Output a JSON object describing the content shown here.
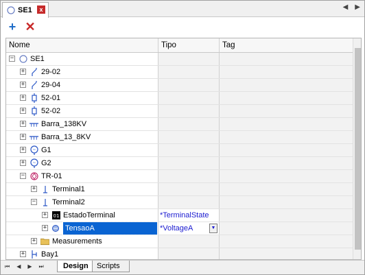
{
  "tab": {
    "title": "SE1",
    "close_glyph": "x"
  },
  "tab_nav": {
    "prev": "◀",
    "next": "▶"
  },
  "toolbar": {
    "add_icon": "plus-icon",
    "delete_icon": "delete-x-icon",
    "add_glyph": "+",
    "delete_glyph": "✕"
  },
  "columns": {
    "name": "Nome",
    "type": "Tipo",
    "tag": "Tag"
  },
  "tree": [
    {
      "label": "SE1",
      "type": "",
      "level": 0,
      "expander": "minus",
      "icon": "circle-icon"
    },
    {
      "label": "29-02",
      "type": "",
      "level": 1,
      "expander": "plus",
      "icon": "switch-icon"
    },
    {
      "label": "29-04",
      "type": "",
      "level": 1,
      "expander": "plus",
      "icon": "switch-icon"
    },
    {
      "label": "52-01",
      "type": "",
      "level": 1,
      "expander": "plus",
      "icon": "breaker-icon"
    },
    {
      "label": "52-02",
      "type": "",
      "level": 1,
      "expander": "plus",
      "icon": "breaker-icon"
    },
    {
      "label": "Barra_138KV",
      "type": "",
      "level": 1,
      "expander": "plus",
      "icon": "busbar-icon"
    },
    {
      "label": "Barra_13_8KV",
      "type": "",
      "level": 1,
      "expander": "plus",
      "icon": "busbar-icon"
    },
    {
      "label": "G1",
      "type": "",
      "level": 1,
      "expander": "plus",
      "icon": "generator-icon"
    },
    {
      "label": "G2",
      "type": "",
      "level": 1,
      "expander": "plus",
      "icon": "generator-icon"
    },
    {
      "label": "TR-01",
      "type": "",
      "level": 1,
      "expander": "minus",
      "icon": "transformer-icon"
    },
    {
      "label": "Terminal1",
      "type": "",
      "level": 2,
      "expander": "plus",
      "icon": "terminal-icon"
    },
    {
      "label": "Terminal2",
      "type": "",
      "level": 2,
      "expander": "minus",
      "icon": "terminal-icon"
    },
    {
      "label": "EstadoTerminal",
      "type": "*TerminalState",
      "level": 3,
      "expander": "plus",
      "icon": "state-icon"
    },
    {
      "label": "TensaoA",
      "type": "*VoltageA",
      "level": 3,
      "expander": "plus",
      "icon": "voltage-icon",
      "selected": true
    },
    {
      "label": "Measurements",
      "type": "",
      "level": 2,
      "expander": "plus",
      "icon": "folder-icon"
    },
    {
      "label": "Bay1",
      "type": "",
      "level": 1,
      "expander": "plus",
      "icon": "bay-icon"
    }
  ],
  "bottom_nav": [
    "⏮",
    "◀",
    "▶",
    "⏭"
  ],
  "bottom_tabs": {
    "design": "Design",
    "scripts": "Scripts"
  }
}
